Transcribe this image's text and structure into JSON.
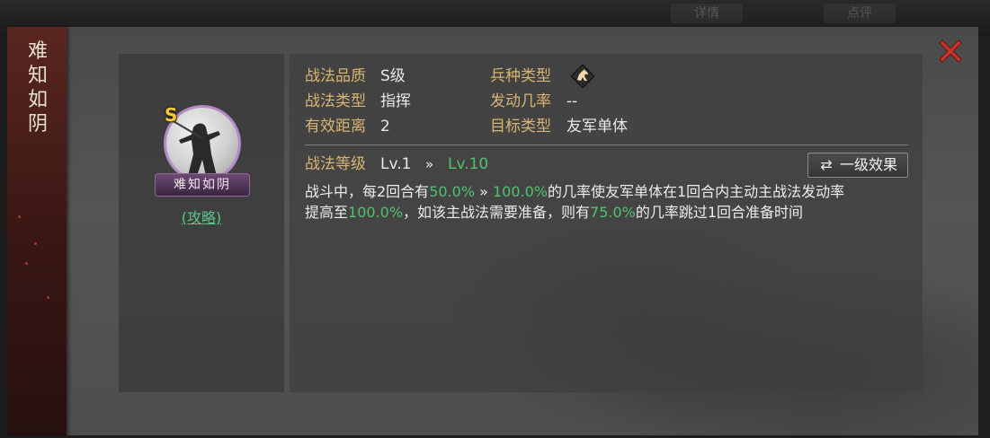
{
  "background": {
    "tabs": [
      "详情",
      "点评"
    ]
  },
  "skill": {
    "vertical_title": "难知如阴",
    "name": "难知如阴",
    "grade_badge": "S",
    "guide_link": "(攻略)"
  },
  "info_rows": [
    {
      "label": "战法品质",
      "value": "S级"
    },
    {
      "label": "战法类型",
      "value": "指挥"
    },
    {
      "label": "有效距离",
      "value": "2"
    }
  ],
  "info_rows_right": [
    {
      "label": "兵种类型",
      "value": "",
      "icon": "cavalry-horse-icon"
    },
    {
      "label": "发动几率",
      "value": "--"
    },
    {
      "label": "目标类型",
      "value": "友军单体"
    }
  ],
  "level": {
    "label": "战法等级",
    "from": "Lv.1",
    "arrow": "»",
    "to": "Lv.10"
  },
  "effect_button": {
    "icon": "swap-arrows-icon",
    "label": "一级效果"
  },
  "description": {
    "p1": "战斗中，每2回合有",
    "v1": "50.0%",
    "arrow1": " » ",
    "v2": "100.0%",
    "p2": "的几率使友军单体在1回合内主动主战法发动率",
    "p3": "提高至",
    "v3": "100.0%",
    "p4": "，如该主战法需要准备，则有",
    "v4": "75.0%",
    "p5": "的几率跳过1回合准备时间"
  },
  "colors": {
    "label_gold": "#d7b472",
    "value_green": "#4fc26e",
    "close_red": "#c8342c",
    "portrait_ring": "#b48ac4"
  }
}
